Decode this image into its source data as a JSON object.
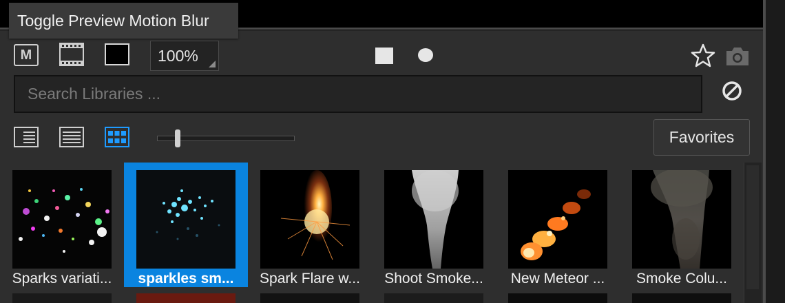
{
  "tooltip": {
    "text": "Toggle Preview Motion Blur"
  },
  "toolbar": {
    "m_label": "M",
    "zoom_value": "100%"
  },
  "search": {
    "placeholder": "Search Libraries ..."
  },
  "favorites_label": "Favorites",
  "colors": {
    "accent": "#0a84e0",
    "panel": "#2e2e2e",
    "grid_icon_active": "#1e9bff"
  },
  "grid": {
    "items": [
      {
        "label": "Sparks variati...",
        "selected": false
      },
      {
        "label": "sparkles sm...",
        "selected": true
      },
      {
        "label": "Spark Flare w...",
        "selected": false
      },
      {
        "label": "Shoot Smoke...",
        "selected": false
      },
      {
        "label": "New Meteor ...",
        "selected": false
      },
      {
        "label": "Smoke Colu...",
        "selected": false
      }
    ]
  },
  "icons": [
    "m-icon",
    "film-strip-icon",
    "background-color-icon",
    "square-shape-icon",
    "circle-shape-icon",
    "star-icon",
    "camera-icon",
    "clear-icon",
    "list-view-icon",
    "detail-view-icon",
    "grid-view-icon"
  ]
}
